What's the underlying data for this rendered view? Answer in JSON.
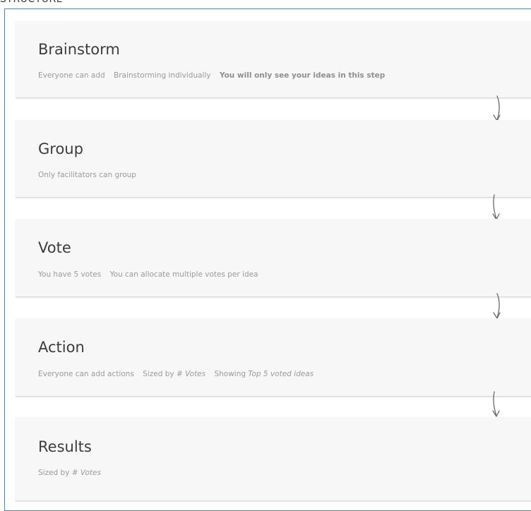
{
  "header": {
    "text": "STRUCTURE"
  },
  "steps": [
    {
      "title": "Brainstorm",
      "meta": [
        "Everyone can add",
        "Brainstorming individually",
        "You will only see your ideas in this step"
      ]
    },
    {
      "title": "Group",
      "meta": [
        "Only facilitators can group"
      ]
    },
    {
      "title": "Vote",
      "meta": [
        "You have 5 votes",
        "You can allocate multiple votes per idea"
      ]
    },
    {
      "title": "Action",
      "meta": {
        "add": "Everyone can add actions",
        "sized_prefix": "Sized by",
        "sized_value": "# Votes",
        "showing_prefix": "Showing",
        "showing_value": "Top 5 voted ideas"
      }
    },
    {
      "title": "Results",
      "meta": {
        "sized_prefix": "Sized by",
        "sized_value": "# Votes"
      }
    }
  ],
  "colors": {
    "frame_border": "#5b80b4",
    "card_bg": "#f7f7f7",
    "title": "#3d3d3d",
    "meta": "#9a9a9a",
    "arrow": "#6a6a6a"
  },
  "icons": [
    "down-arrow-icon"
  ]
}
